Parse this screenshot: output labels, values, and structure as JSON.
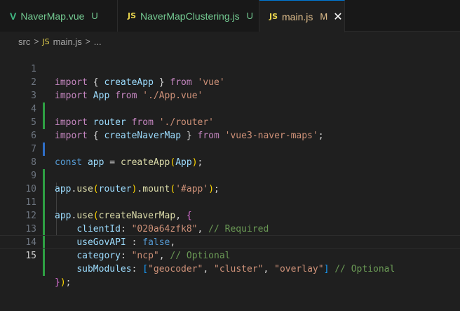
{
  "tabs": [
    {
      "icon": "V",
      "label": "NaverMap.vue",
      "status": "U"
    },
    {
      "icon": "JS",
      "label": "NaverMapClustering.js",
      "status": "U"
    },
    {
      "icon": "JS",
      "label": "main.js",
      "status": "M",
      "close": "✕"
    }
  ],
  "breadcrumb": {
    "folder": "src",
    "sep": ">",
    "file_icon": "JS",
    "file": "main.js",
    "more": "..."
  },
  "line_numbers": [
    "1",
    "2",
    "3",
    "4",
    "5",
    "6",
    "7",
    "8",
    "9",
    "10",
    "11",
    "12",
    "13",
    "14",
    "15"
  ],
  "code": {
    "l1": {
      "t1": "import",
      "t2": " { ",
      "t3": "createApp",
      "t4": " } ",
      "t5": "from",
      "t6": " ",
      "t7": "'vue'"
    },
    "l2": {
      "t1": "import",
      "t2": " ",
      "t3": "App",
      "t4": " ",
      "t5": "from",
      "t6": " ",
      "t7": "'./App.vue'"
    },
    "l3": {
      "t1": "import",
      "t2": " ",
      "t3": "router",
      "t4": " ",
      "t5": "from",
      "t6": " ",
      "t7": "'./router'"
    },
    "l4": {
      "t1": "import",
      "t2": " { ",
      "t3": "createNaverMap",
      "t4": " } ",
      "t5": "from",
      "t6": " ",
      "t7": "'vue3-naver-maps'",
      "t8": ";"
    },
    "l6": {
      "t1": "const",
      "t2": " ",
      "t3": "app",
      "t4": " = ",
      "t5": "createApp",
      "t6": "(",
      "t7": "App",
      "t8": ")",
      "t9": ";"
    },
    "l8": {
      "t1": "app",
      "t2": ".",
      "t3": "use",
      "t4": "(",
      "t5": "router",
      "t6": ")",
      "t7": ".",
      "t8": "mount",
      "t9": "(",
      "t10": "'#app'",
      "t11": ")",
      "t12": ";"
    },
    "l10": {
      "t1": "app",
      "t2": ".",
      "t3": "use",
      "t4": "(",
      "t5": "createNaverMap",
      "t6": ", ",
      "t7": "{"
    },
    "l11": {
      "t1": "    ",
      "t2": "clientId",
      "t3": ": ",
      "t4": "\"020a64zfk8\"",
      "t5": ", ",
      "t6": "// Required"
    },
    "l12": {
      "t1": "    ",
      "t2": "useGovAPI",
      "t3": " : ",
      "t4": "false",
      "t5": ","
    },
    "l13": {
      "t1": "    ",
      "t2": "category",
      "t3": ": ",
      "t4": "\"ncp\"",
      "t5": ", ",
      "t6": "// Optional"
    },
    "l14": {
      "t1": "    ",
      "t2": "subModules",
      "t3": ": ",
      "t4": "[",
      "t5": "\"geocoder\"",
      "t6": ", ",
      "t7": "\"cluster\"",
      "t8": ", ",
      "t9": "\"overlay\"",
      "t10": "]",
      "t11": " ",
      "t12": "// Optional"
    },
    "l15": {
      "t1": "}",
      "t2": ")",
      "t3": ";"
    }
  },
  "colors": {
    "keyword": "#569cd6",
    "control": "#c586c0",
    "variable": "#9cdcfe",
    "function": "#dcdcaa",
    "string": "#ce9178",
    "comment": "#6a9955",
    "added": "#2ea043",
    "modified": "#2f6ec6"
  }
}
